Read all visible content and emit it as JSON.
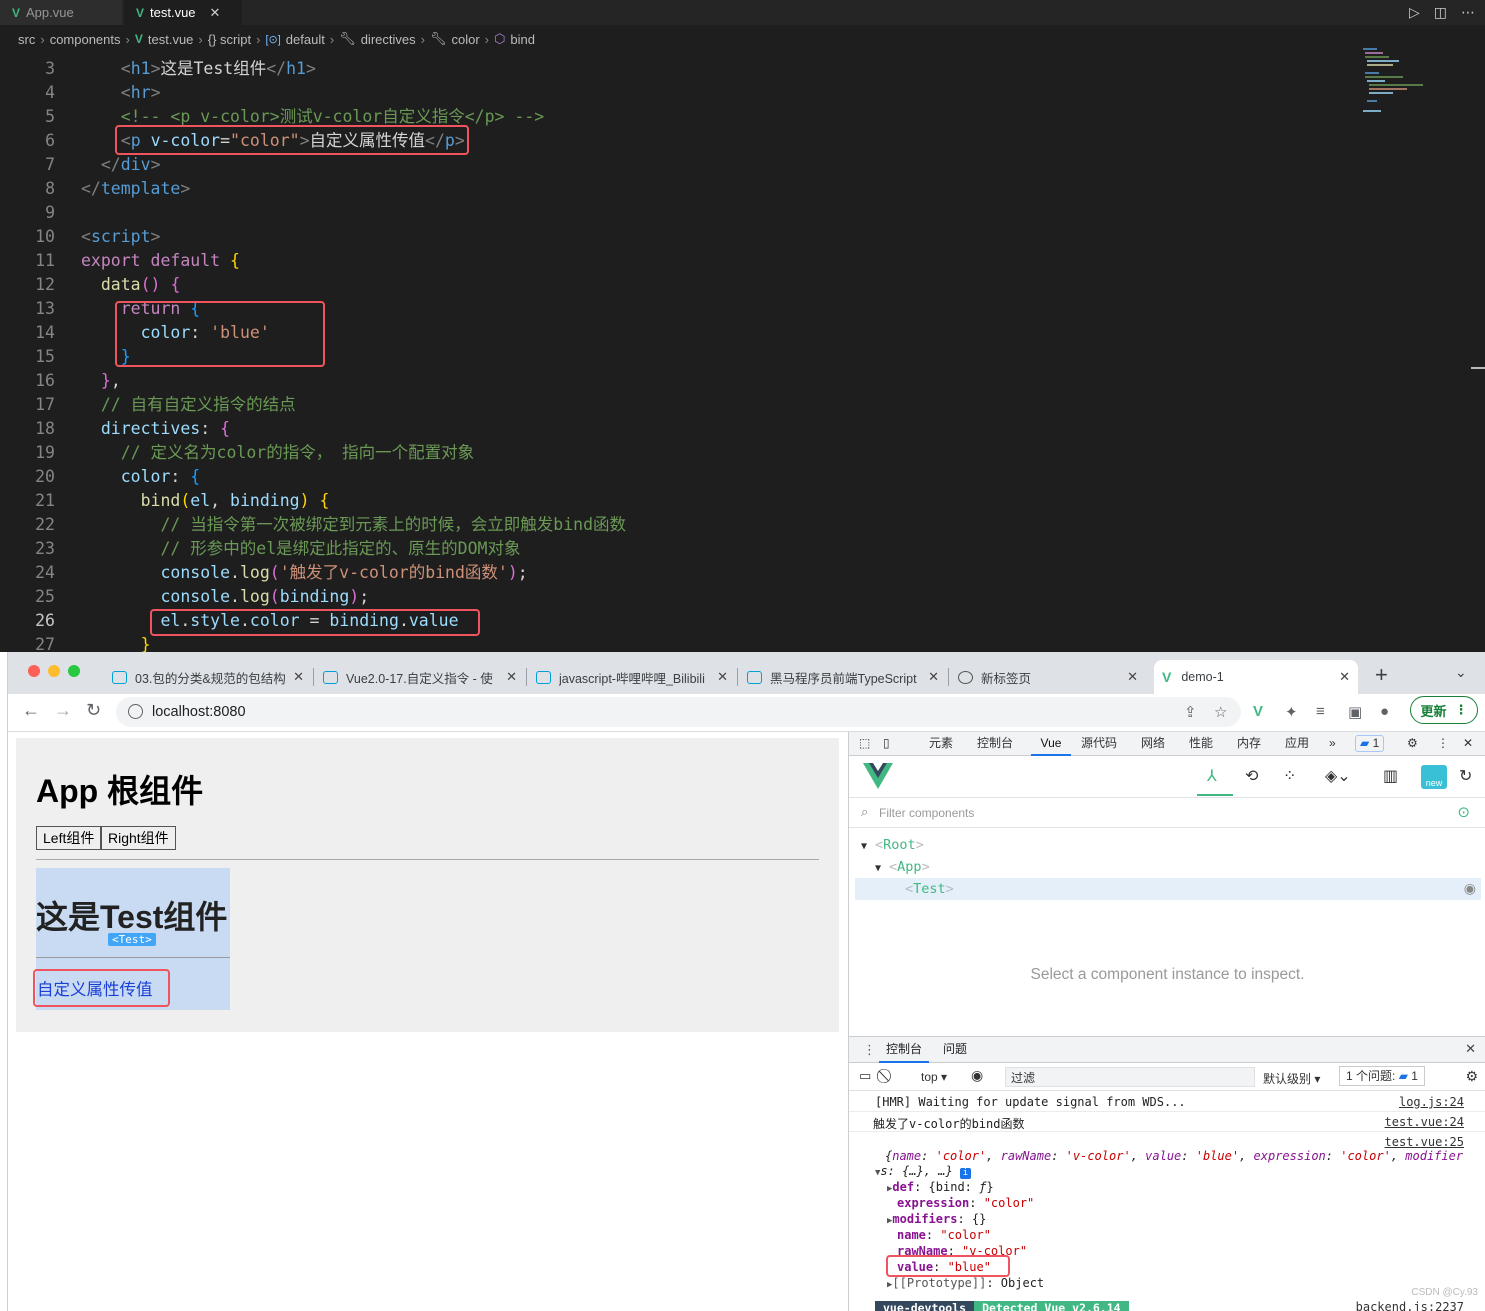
{
  "editor": {
    "tabs": [
      {
        "label": "App.vue",
        "active": false
      },
      {
        "label": "test.vue",
        "active": true
      }
    ],
    "breadcrumb": [
      "src",
      "components",
      "test.vue",
      "{} script",
      "default",
      "directives",
      "color",
      "bind"
    ],
    "current_line": "26",
    "code": [
      {
        "n": "3",
        "html": "    <span class='c-punc'>&lt;</span><span class='c-tag'>h1</span><span class='c-punc'>&gt;</span>这是Test组件<span class='c-punc'>&lt;/</span><span class='c-tag'>h1</span><span class='c-punc'>&gt;</span>"
      },
      {
        "n": "4",
        "html": "    <span class='c-punc'>&lt;</span><span class='c-tag'>hr</span><span class='c-punc'>&gt;</span>"
      },
      {
        "n": "5",
        "html": "    <span class='c-com'>&lt;!-- &lt;p v-color&gt;测试v-color自定义指令&lt;/p&gt; --&gt;</span>"
      },
      {
        "n": "6",
        "html": "    <span class='c-punc'>&lt;</span><span class='c-tag'>p</span> <span class='c-attr'>v-color</span>=<span class='c-str'>\"color\"</span><span class='c-punc'>&gt;</span>自定义属性传值<span class='c-punc'>&lt;/</span><span class='c-tag'>p</span><span class='c-punc'>&gt;</span>"
      },
      {
        "n": "7",
        "html": "  <span class='c-punc'>&lt;/</span><span class='c-tag'>div</span><span class='c-punc'>&gt;</span>"
      },
      {
        "n": "8",
        "html": "<span class='c-punc'>&lt;/</span><span class='c-tag'>template</span><span class='c-punc'>&gt;</span>"
      },
      {
        "n": "9",
        "html": ""
      },
      {
        "n": "10",
        "html": "<span class='c-punc'>&lt;</span><span class='c-tag'>script</span><span class='c-punc'>&gt;</span>"
      },
      {
        "n": "11",
        "html": "<span class='c-kw'>export default</span> <span class='c-br1'>{</span>"
      },
      {
        "n": "12",
        "html": "  <span class='c-fn'>data</span><span class='c-br2'>()</span> <span class='c-br2'>{</span>"
      },
      {
        "n": "13",
        "html": "    <span class='c-kw'>return</span> <span class='c-br3'>{</span>"
      },
      {
        "n": "14",
        "html": "      <span class='c-var'>color</span>: <span class='c-str'>'blue'</span>"
      },
      {
        "n": "15",
        "html": "    <span class='c-br3'>}</span>"
      },
      {
        "n": "16",
        "html": "  <span class='c-br2'>}</span>,"
      },
      {
        "n": "17",
        "html": "  <span class='c-com'>// 自有自定义指令的结点</span>"
      },
      {
        "n": "18",
        "html": "  <span class='c-var'>directives</span>: <span class='c-br2'>{</span>"
      },
      {
        "n": "19",
        "html": "    <span class='c-com'>// 定义名为color的指令， 指向一个配置对象</span>"
      },
      {
        "n": "20",
        "html": "    <span class='c-var'>color</span>: <span class='c-br3'>{</span>"
      },
      {
        "n": "21",
        "html": "      <span class='c-fn'>bind</span><span class='c-br1'>(</span><span class='c-var'>el</span>, <span class='c-var'>binding</span><span class='c-br1'>)</span> <span class='c-br1'>{</span>"
      },
      {
        "n": "22",
        "html": "        <span class='c-com'>// 当指令第一次被绑定到元素上的时候，会立即触发bind函数</span>"
      },
      {
        "n": "23",
        "html": "        <span class='c-com'>// 形参中的el是绑定此指定的、原生的DOM对象</span>"
      },
      {
        "n": "24",
        "html": "        <span class='c-var'>console</span>.<span class='c-fn'>log</span><span class='c-br2'>(</span><span class='c-str'>'触发了v-color的bind函数'</span><span class='c-br2'>)</span>;"
      },
      {
        "n": "25",
        "html": "        <span class='c-var'>console</span>.<span class='c-fn'>log</span><span class='c-br2'>(</span><span class='c-var'>binding</span><span class='c-br2'>)</span>;"
      },
      {
        "n": "26",
        "html": "        <span class='c-var'>el</span>.<span class='c-var'>style</span>.<span class='c-var'>color</span> = <span class='c-var'>binding</span>.<span class='c-var'>value</span>"
      },
      {
        "n": "27",
        "html": "      <span class='c-br1'>}</span>"
      }
    ]
  },
  "browser": {
    "tabs": [
      {
        "title": "03.包的分类&规范的包结构",
        "active": false
      },
      {
        "title": "Vue2.0-17.自定义指令 - 使",
        "active": false
      },
      {
        "title": "javascript-哔哩哔哩_Bilibili",
        "active": false
      },
      {
        "title": "黑马程序员前端TypeScript",
        "active": false
      },
      {
        "title": "新标签页",
        "active": false
      },
      {
        "title": "demo-1",
        "active": true
      }
    ],
    "url": "localhost:8080",
    "update_label": "更新"
  },
  "page": {
    "app_title": "App 根组件",
    "left_button": "Left组件",
    "right_button": "Right组件",
    "test_title": "这是Test组件",
    "test_badge": "<Test>",
    "test_paragraph": "自定义属性传值",
    "paragraph_color": "#1a3fd6"
  },
  "devtools": {
    "tabs": [
      "元素",
      "控制台",
      "Vue",
      "源代码",
      "网络",
      "性能",
      "内存",
      "应用"
    ],
    "active_tab": "Vue",
    "issues_count": "1",
    "new_badge": "new",
    "filter_placeholder": "Filter components",
    "tree": {
      "root": "Root",
      "app": "App",
      "test": "Test",
      "angle_open": "<",
      "angle_close": ">"
    },
    "inspect_message": "Select a component instance to inspect.",
    "drawer_tabs": [
      "控制台",
      "问题"
    ],
    "console": {
      "context": "top ▾",
      "filter_value": "过滤",
      "level": "默认级别 ▾",
      "issues_label": "1 个问题:",
      "issues_count": "1",
      "lines": [
        {
          "text": "[HMR] Waiting for update signal from WDS...",
          "src": "log.js:24"
        },
        {
          "text": "触发了v-color的bind函数",
          "src": "test.vue:24"
        },
        {
          "text": "",
          "src": "test.vue:25"
        }
      ],
      "backend_src": "backend.js:2237"
    },
    "badge_left": "vue-devtools",
    "badge_right": "Detected Vue v2.6.14",
    "badge_left_color": "#35495e",
    "badge_right_color": "#41b883"
  },
  "watermark": "CSDN @Cy.93"
}
